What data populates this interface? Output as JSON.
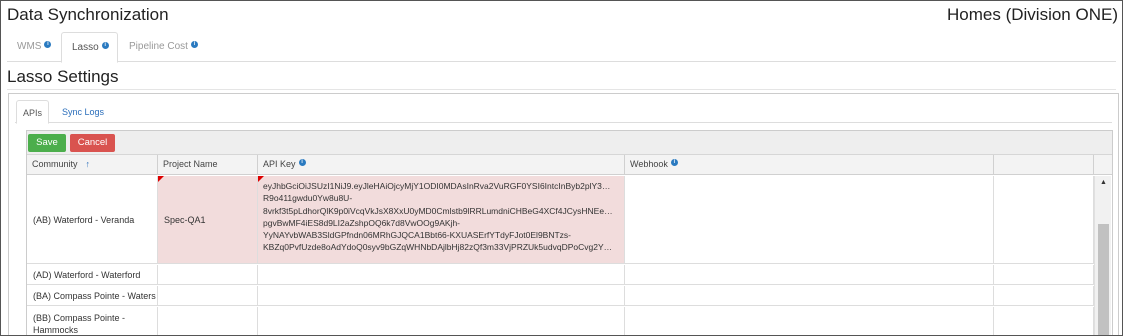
{
  "app_title": "Data Synchronization",
  "org_title": "Homes (Division ONE)",
  "top_tabs": [
    {
      "label": "WMS",
      "active": false
    },
    {
      "label": "Lasso",
      "active": true
    },
    {
      "label": "Pipeline Cost",
      "active": false
    }
  ],
  "info_icon_glyph": "i",
  "section_title": "Lasso Settings",
  "sub_tabs": [
    {
      "label": "APIs",
      "active": true
    },
    {
      "label": "Sync Logs",
      "active": false
    }
  ],
  "toolbar": {
    "save_label": "Save",
    "cancel_label": "Cancel"
  },
  "grid": {
    "columns": [
      {
        "label": "Community",
        "sorted": "ascending"
      },
      {
        "label": "Project Name"
      },
      {
        "label": "API Key",
        "info": true
      },
      {
        "label": "Webhook",
        "info": true
      },
      {
        "label": ""
      }
    ],
    "rows": [
      {
        "community": "(AB) Waterford - Veranda",
        "project_name": "Spec-QA1",
        "api_key_lines": [
          "eyJhbGciOiJSUzI1NiJ9.eyJleHAiOjcyMjY1ODI0MDAsInRva2VuRGF0YSI6IntcInByb2plY3…",
          "R9o411gwdu0Yw8u8U-",
          "8vrkf3t5pLdhorQlK9p0iVcqVkJsX8XxU0yMD0Cmlstb9lRRLumdniCHBeG4XCf4JCysHNEe…",
          "pgvBwMF4iES8d9LI2aZshpOQ6k7d8VwOOg9AKjh-",
          "YyNAYvbWAB3SldGPfndn06MRhGJQCA1Bbt66-KXUASErfYTdyFJot0El9BNTzs-",
          "KBZq0PvfUzde8oAdYdoQ0syv9bGZqWHNbDAjlbHj82zQf3m33VjPRZUk5udvqDPoCvg2Y…"
        ],
        "webhook": "",
        "invalid": true
      },
      {
        "community": "(AD) Waterford - Waterford",
        "project_name": "",
        "webhook": ""
      },
      {
        "community": "(BA) Compass Pointe - Waters",
        "project_name": "",
        "webhook": ""
      },
      {
        "community_lines": [
          "(BB) Compass Pointe -",
          "Hammocks"
        ],
        "project_name": "",
        "webhook": ""
      }
    ]
  },
  "scrollbar": {
    "up_glyph": "▲"
  },
  "colors": {
    "save": "#4cae4c",
    "cancel": "#d9534f",
    "invalid_cell": "#f2dcdc",
    "info": "#2a7ac0",
    "link": "#2a6ebb"
  }
}
